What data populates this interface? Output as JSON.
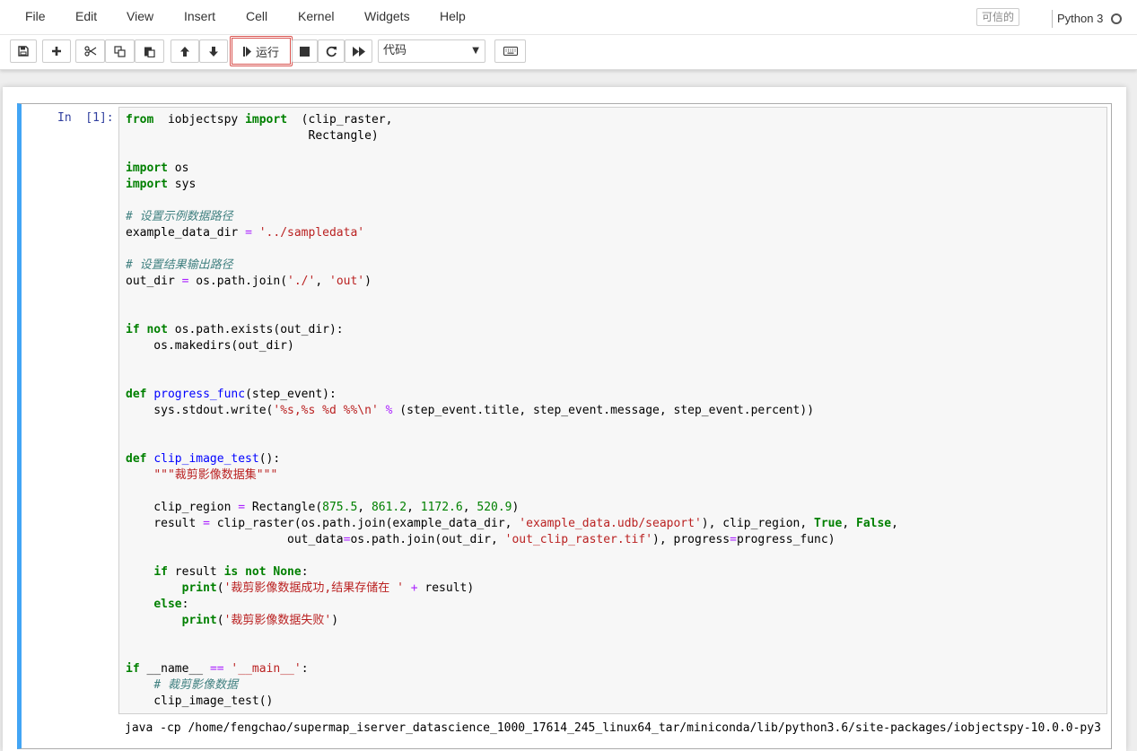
{
  "menubar": {
    "items": [
      "File",
      "Edit",
      "View",
      "Insert",
      "Cell",
      "Kernel",
      "Widgets",
      "Help"
    ],
    "trusted_label": "可信的",
    "kernel_name": "Python 3"
  },
  "toolbar": {
    "run_label": "运行",
    "cell_type": "代码"
  },
  "cell": {
    "prompt": "In  [1]:",
    "code_lines": [
      [
        [
          "kw",
          "from"
        ],
        [
          "",
          "  iobjectspy "
        ],
        [
          "kw",
          "import"
        ],
        [
          "",
          "  (clip_raster,"
        ]
      ],
      [
        [
          "",
          "                          Rectangle)"
        ]
      ],
      [],
      [
        [
          "kw",
          "import"
        ],
        [
          "",
          " os"
        ]
      ],
      [
        [
          "kw",
          "import"
        ],
        [
          "",
          " sys"
        ]
      ],
      [],
      [
        [
          "cm",
          "# 设置示例数据路径"
        ]
      ],
      [
        [
          "",
          "example_data_dir "
        ],
        [
          "op",
          "="
        ],
        [
          "",
          ""
        ],
        [
          "st",
          " '../sampledata'"
        ]
      ],
      [],
      [
        [
          "cm",
          "# 设置结果输出路径"
        ]
      ],
      [
        [
          "",
          "out_dir "
        ],
        [
          "op",
          "="
        ],
        [
          "",
          " os.path.join("
        ],
        [
          "st",
          "'./'"
        ],
        [
          "",
          ", "
        ],
        [
          "st",
          "'out'"
        ],
        [
          "",
          ")"
        ]
      ],
      [],
      [],
      [
        [
          "kw",
          "if"
        ],
        [
          "",
          " "
        ],
        [
          "kw",
          "not"
        ],
        [
          "",
          " os.path.exists(out_dir):"
        ]
      ],
      [
        [
          "",
          "    os.makedirs(out_dir)"
        ]
      ],
      [],
      [],
      [
        [
          "kw",
          "def"
        ],
        [
          "",
          " "
        ],
        [
          "fn",
          "progress_func"
        ],
        [
          "",
          "(step_event):"
        ]
      ],
      [
        [
          "",
          "    sys.stdout.write("
        ],
        [
          "st",
          "'%s,%s %d %%\\n'"
        ],
        [
          "",
          " "
        ],
        [
          "op",
          "%"
        ],
        [
          "",
          " (step_event.title, step_event.message, step_event.percent))"
        ]
      ],
      [],
      [],
      [
        [
          "kw",
          "def"
        ],
        [
          "",
          " "
        ],
        [
          "fn",
          "clip_image_test"
        ],
        [
          "",
          "():"
        ]
      ],
      [
        [
          "",
          "    "
        ],
        [
          "st",
          "\"\"\"裁剪影像数据集\"\"\""
        ]
      ],
      [],
      [
        [
          "",
          "    clip_region "
        ],
        [
          "op",
          "="
        ],
        [
          "",
          " Rectangle("
        ],
        [
          "nu",
          "875.5"
        ],
        [
          "",
          ", "
        ],
        [
          "nu",
          "861.2"
        ],
        [
          "",
          ", "
        ],
        [
          "nu",
          "1172.6"
        ],
        [
          "",
          ", "
        ],
        [
          "nu",
          "520.9"
        ],
        [
          "",
          ")"
        ]
      ],
      [
        [
          "",
          "    result "
        ],
        [
          "op",
          "="
        ],
        [
          "",
          " clip_raster(os.path.join(example_data_dir, "
        ],
        [
          "st",
          "'example_data.udb/seaport'"
        ],
        [
          "",
          "), clip_region, "
        ],
        [
          "kw",
          "True"
        ],
        [
          "",
          ", "
        ],
        [
          "kw",
          "False"
        ],
        [
          "",
          ","
        ]
      ],
      [
        [
          "",
          "                       out_data"
        ],
        [
          "op",
          "="
        ],
        [
          "",
          "os.path.join(out_dir, "
        ],
        [
          "st",
          "'out_clip_raster.tif'"
        ],
        [
          "",
          "), progress"
        ],
        [
          "op",
          "="
        ],
        [
          "",
          "progress_func)"
        ]
      ],
      [],
      [
        [
          "",
          "    "
        ],
        [
          "kw",
          "if"
        ],
        [
          "",
          " result "
        ],
        [
          "kw",
          "is not None"
        ],
        [
          "",
          ":"
        ]
      ],
      [
        [
          "",
          "        "
        ],
        [
          "kw",
          "print"
        ],
        [
          "",
          "("
        ],
        [
          "st",
          "'裁剪影像数据成功,结果存储在 '"
        ],
        [
          "",
          " "
        ],
        [
          "op",
          "+"
        ],
        [
          "",
          " result)"
        ]
      ],
      [
        [
          "",
          "    "
        ],
        [
          "kw",
          "else"
        ],
        [
          "",
          ":"
        ]
      ],
      [
        [
          "",
          "        "
        ],
        [
          "kw",
          "print"
        ],
        [
          "",
          "("
        ],
        [
          "st",
          "'裁剪影像数据失败'"
        ],
        [
          "",
          ")"
        ]
      ],
      [],
      [],
      [
        [
          "kw",
          "if"
        ],
        [
          "",
          " __name__ "
        ],
        [
          "op",
          "=="
        ],
        [
          "st",
          " '__main__'"
        ],
        [
          "",
          ":"
        ]
      ],
      [
        [
          "",
          "    "
        ],
        [
          "cm",
          "# 裁剪影像数据"
        ]
      ],
      [
        [
          "",
          "    clip_image_test()"
        ]
      ]
    ],
    "output": "java -cp /home/fengchao/supermap_iserver_datascience_1000_17614_245_linux64_tar/miniconda/lib/python3.6/site-packages/iobjectspy-10.0.0-py3."
  },
  "colors": {
    "cell_selected_border": "#42a5f5",
    "keyword": "#008000",
    "string": "#ba2121",
    "comment": "#408080",
    "function_name": "#0000ff",
    "operator": "#aa22ff",
    "prompt": "#303f9f",
    "run_highlight": "#d9534f"
  },
  "icons": [
    "save-icon",
    "plus-icon",
    "scissors-icon",
    "copy-icon",
    "paste-icon",
    "arrow-up-icon",
    "arrow-down-icon",
    "step-forward-icon",
    "stop-icon",
    "restart-icon",
    "fast-forward-icon",
    "keyboard-icon",
    "circle-outline-icon"
  ]
}
